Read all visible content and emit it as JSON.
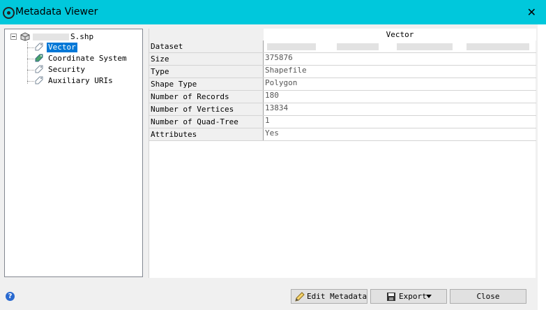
{
  "window": {
    "title": "Metadata Viewer",
    "close_glyph": "✕"
  },
  "tree": {
    "root_label_suffix": "S.shp",
    "items": [
      {
        "label": "Vector",
        "selected": true
      },
      {
        "label": "Coordinate System",
        "selected": false
      },
      {
        "label": "Security",
        "selected": false
      },
      {
        "label": "Auxiliary URIs",
        "selected": false
      }
    ]
  },
  "grid": {
    "column_header": "Vector",
    "rows": [
      {
        "key": "Dataset",
        "value": ""
      },
      {
        "key": "Size",
        "value": "375876"
      },
      {
        "key": "Type",
        "value": "Shapefile"
      },
      {
        "key": "Shape Type",
        "value": "Polygon"
      },
      {
        "key": "Number of Records",
        "value": "180"
      },
      {
        "key": "Number of Vertices",
        "value": "13834"
      },
      {
        "key": "Number of Quad-Tree Nodes",
        "value": "1"
      },
      {
        "key": "Attributes",
        "value": "Yes"
      }
    ]
  },
  "buttons": {
    "edit_metadata": "Edit Metadata",
    "export": "Export",
    "close": "Close"
  },
  "help": {
    "glyph": "?"
  },
  "colors": {
    "titlebar": "#00c8dc",
    "selection": "#0078d7"
  },
  "icons": [
    "app-icon",
    "close-icon",
    "dataset-icon",
    "tag-icon",
    "edit-icon",
    "save-icon",
    "dropdown-arrow-icon",
    "help-icon"
  ]
}
